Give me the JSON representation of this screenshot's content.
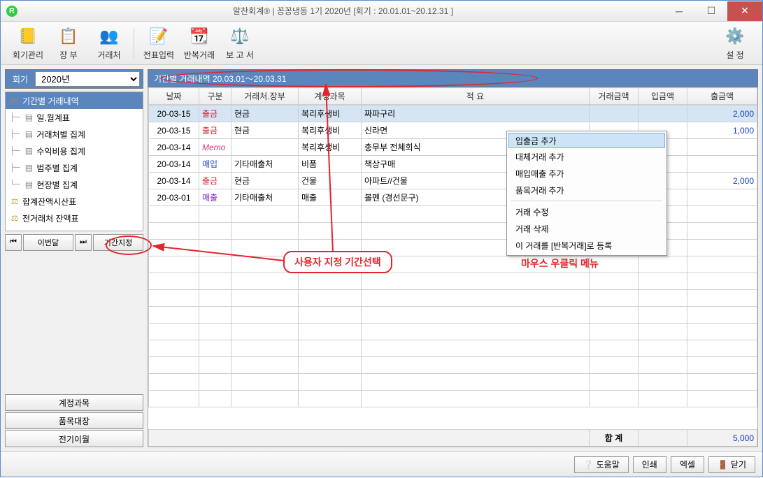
{
  "window": {
    "app_icon_letter": "R",
    "title": "알찬회계® | 꽁꽁냉동 1기 2020년 [회기 : 20.01.01~20.12.31 ]"
  },
  "toolbar": {
    "items": [
      {
        "label": "회기관리",
        "icon": "📒"
      },
      {
        "label": "장 부",
        "icon": "📋"
      },
      {
        "label": "거래처",
        "icon": "👥"
      },
      {
        "label": "전표입력",
        "icon": "📝"
      },
      {
        "label": "반복거래",
        "icon": "📆"
      },
      {
        "label": "보 고 서",
        "icon": "⚖️"
      }
    ],
    "settings_label": "설 정",
    "settings_icon": "⚙️"
  },
  "left": {
    "period_label": "회기",
    "period_value": "2020년",
    "tree": [
      {
        "label": "기간별 거래내역",
        "sel": true,
        "icon": "doc",
        "child": false
      },
      {
        "label": "일.월계표",
        "icon": "doc",
        "child": true
      },
      {
        "label": "거래처별 집계",
        "icon": "doc",
        "child": true
      },
      {
        "label": "수익비용 집계",
        "icon": "doc",
        "child": true
      },
      {
        "label": "범주별 집계",
        "icon": "doc",
        "child": true
      },
      {
        "label": "현장별 집계",
        "icon": "doc",
        "child": true,
        "last": true
      },
      {
        "label": "합계잔액시산표",
        "icon": "scale",
        "child": false
      },
      {
        "label": "전거래처 잔액표",
        "icon": "scale",
        "child": false
      }
    ],
    "nav": {
      "first": "⏮",
      "this_month": "이번달",
      "last": "⏭",
      "set_period": "기간지정"
    },
    "buttons": [
      "계정과목",
      "품목대장",
      "전기이월"
    ]
  },
  "range_header": "기간별 거래내역  20.03.01～20.03.31",
  "grid": {
    "cols": [
      "날짜",
      "구분",
      "거래처.장부",
      "계정과목",
      "적 요",
      "거래금액",
      "입금액",
      "출금액"
    ],
    "rows": [
      {
        "date": "20-03-15",
        "type": "출금",
        "typecls": "type-out",
        "party": "현금",
        "acct": "복리후생비",
        "desc": "짜파구리",
        "amt": "",
        "in": "",
        "out": "2,000",
        "sel": true
      },
      {
        "date": "20-03-15",
        "type": "출금",
        "typecls": "type-out",
        "party": "현금",
        "acct": "복리후생비",
        "desc": "신라면",
        "amt": "",
        "in": "",
        "out": "1,000"
      },
      {
        "date": "20-03-14",
        "type": "Memo",
        "typecls": "type-memo",
        "party": "",
        "acct": "복리후생비",
        "desc": "총무부 전체회식",
        "amt": "",
        "in": "",
        "out": ""
      },
      {
        "date": "20-03-14",
        "type": "매입",
        "typecls": "type-in",
        "party": "기타매출처",
        "acct": "비품",
        "desc": "책상구매",
        "amt": "",
        "in": "",
        "out": ""
      },
      {
        "date": "20-03-14",
        "type": "출금",
        "typecls": "type-out",
        "party": "현금",
        "acct": "건물",
        "desc": "아파트//건물",
        "amt": "",
        "in": "",
        "out": "2,000"
      },
      {
        "date": "20-03-01",
        "type": "매출",
        "typecls": "type-sale",
        "party": "기타매출처",
        "acct": "매출",
        "desc": "볼펜 (경선문구)",
        "amt": "",
        "in": "",
        "out": ""
      }
    ],
    "footer": {
      "label": "합 계",
      "in": "",
      "out": "5,000"
    }
  },
  "context_menu": {
    "items": [
      {
        "label": "입출금 추가",
        "sel": true
      },
      {
        "label": "대체거래 추가"
      },
      {
        "label": "매입매출 추가"
      },
      {
        "label": "품목거래 추가"
      },
      {
        "sep": true
      },
      {
        "label": "거래 수정"
      },
      {
        "label": "거래 삭제"
      },
      {
        "label": "이 거래를 [반복거래]로 등록"
      }
    ]
  },
  "annotations": {
    "period_callout": "사용자 지정 기간선택",
    "ctx_callout": "마우스 우클릭 메뉴"
  },
  "bottom": {
    "help": "도움말",
    "print": "인쇄",
    "excel": "엑셀",
    "close": "닫기"
  }
}
